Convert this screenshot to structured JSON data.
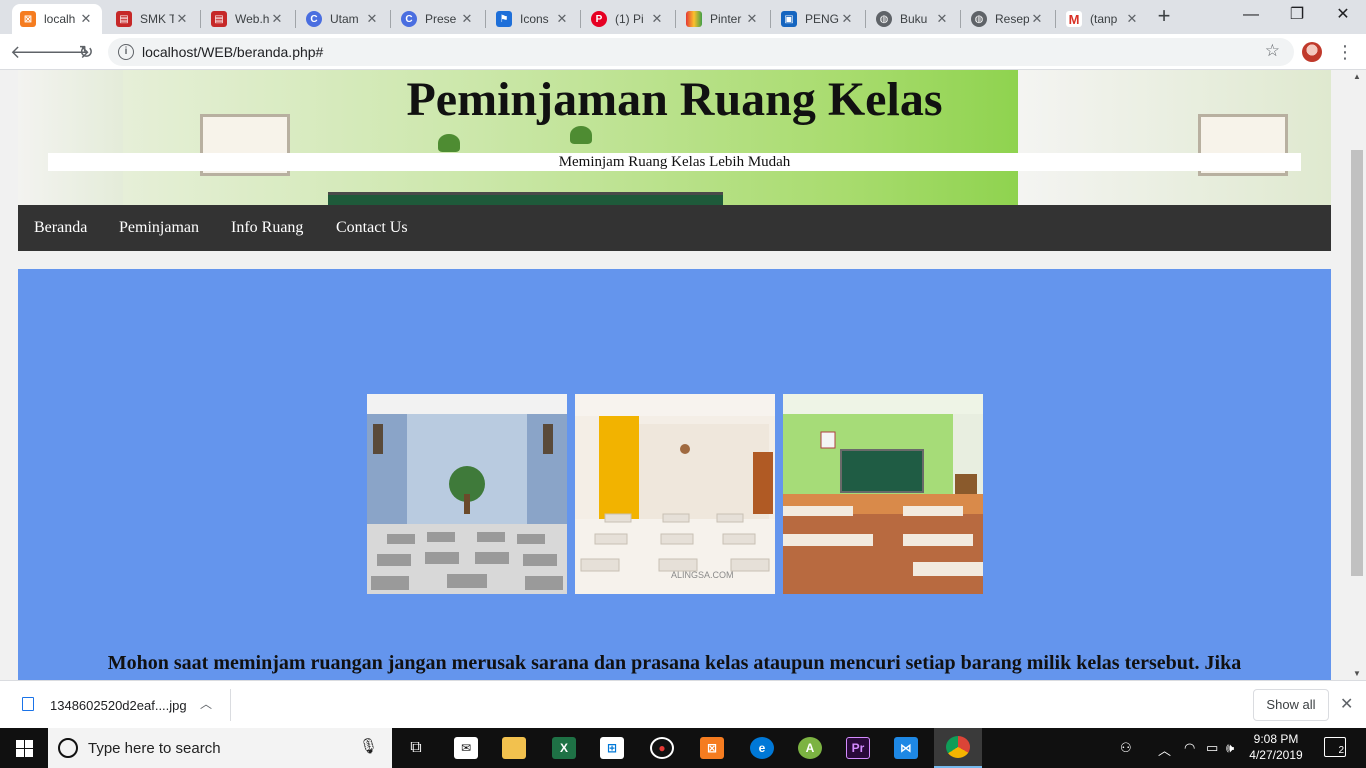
{
  "browser": {
    "tabs": [
      {
        "title": "localh",
        "favicon_color": "#f57c20",
        "favicon_glyph": "▣",
        "active": true
      },
      {
        "title": "SMK T",
        "favicon_color": "#c62828",
        "favicon_glyph": "▤"
      },
      {
        "title": "Web.h",
        "favicon_color": "#c62828",
        "favicon_glyph": "▤"
      },
      {
        "title": "Utam",
        "favicon_color": "#4a6ee0",
        "favicon_glyph": "C"
      },
      {
        "title": "Prese",
        "favicon_color": "#4a6ee0",
        "favicon_glyph": "C"
      },
      {
        "title": "Icons",
        "favicon_color": "#1e6fd9",
        "favicon_glyph": "▶"
      },
      {
        "title": "(1) Pi",
        "favicon_color": "#e60023",
        "favicon_glyph": "P"
      },
      {
        "title": "Pinter",
        "favicon_color": "#f4b400",
        "favicon_glyph": "▲"
      },
      {
        "title": "PENG",
        "favicon_color": "#1565c0",
        "favicon_glyph": "▣"
      },
      {
        "title": "Buku",
        "favicon_color": "#5f6368",
        "favicon_glyph": "◍"
      },
      {
        "title": "Resep",
        "favicon_color": "#5f6368",
        "favicon_glyph": "◍"
      },
      {
        "title": "(tanp",
        "favicon_color": "#d93025",
        "favicon_glyph": "M"
      }
    ],
    "url": "localhost/WEB/beranda.php#",
    "window_controls": {
      "minimize": "—",
      "restore": "❐",
      "close": "✕"
    }
  },
  "site": {
    "title": "Peminjaman Ruang Kelas",
    "subtitle": "Meminjam Ruang Kelas Lebih Mudah",
    "nav": [
      "Beranda",
      "Peminjaman",
      "Info Ruang",
      "Contact Us"
    ],
    "notice": "Mohon saat meminjam ruangan jangan merusak sarana dan prasana kelas ataupun mencuri setiap barang milik kelas tersebut. Jika",
    "content_bg": "#6495ed",
    "photo_watermark": "ALINGSA.COM"
  },
  "downloads": {
    "filename": "1348602520d2eaf....jpg",
    "show_all": "Show all"
  },
  "taskbar": {
    "search_placeholder": "Type here to search",
    "time": "9:08 PM",
    "date": "4/27/2019",
    "notification_count": "2"
  }
}
